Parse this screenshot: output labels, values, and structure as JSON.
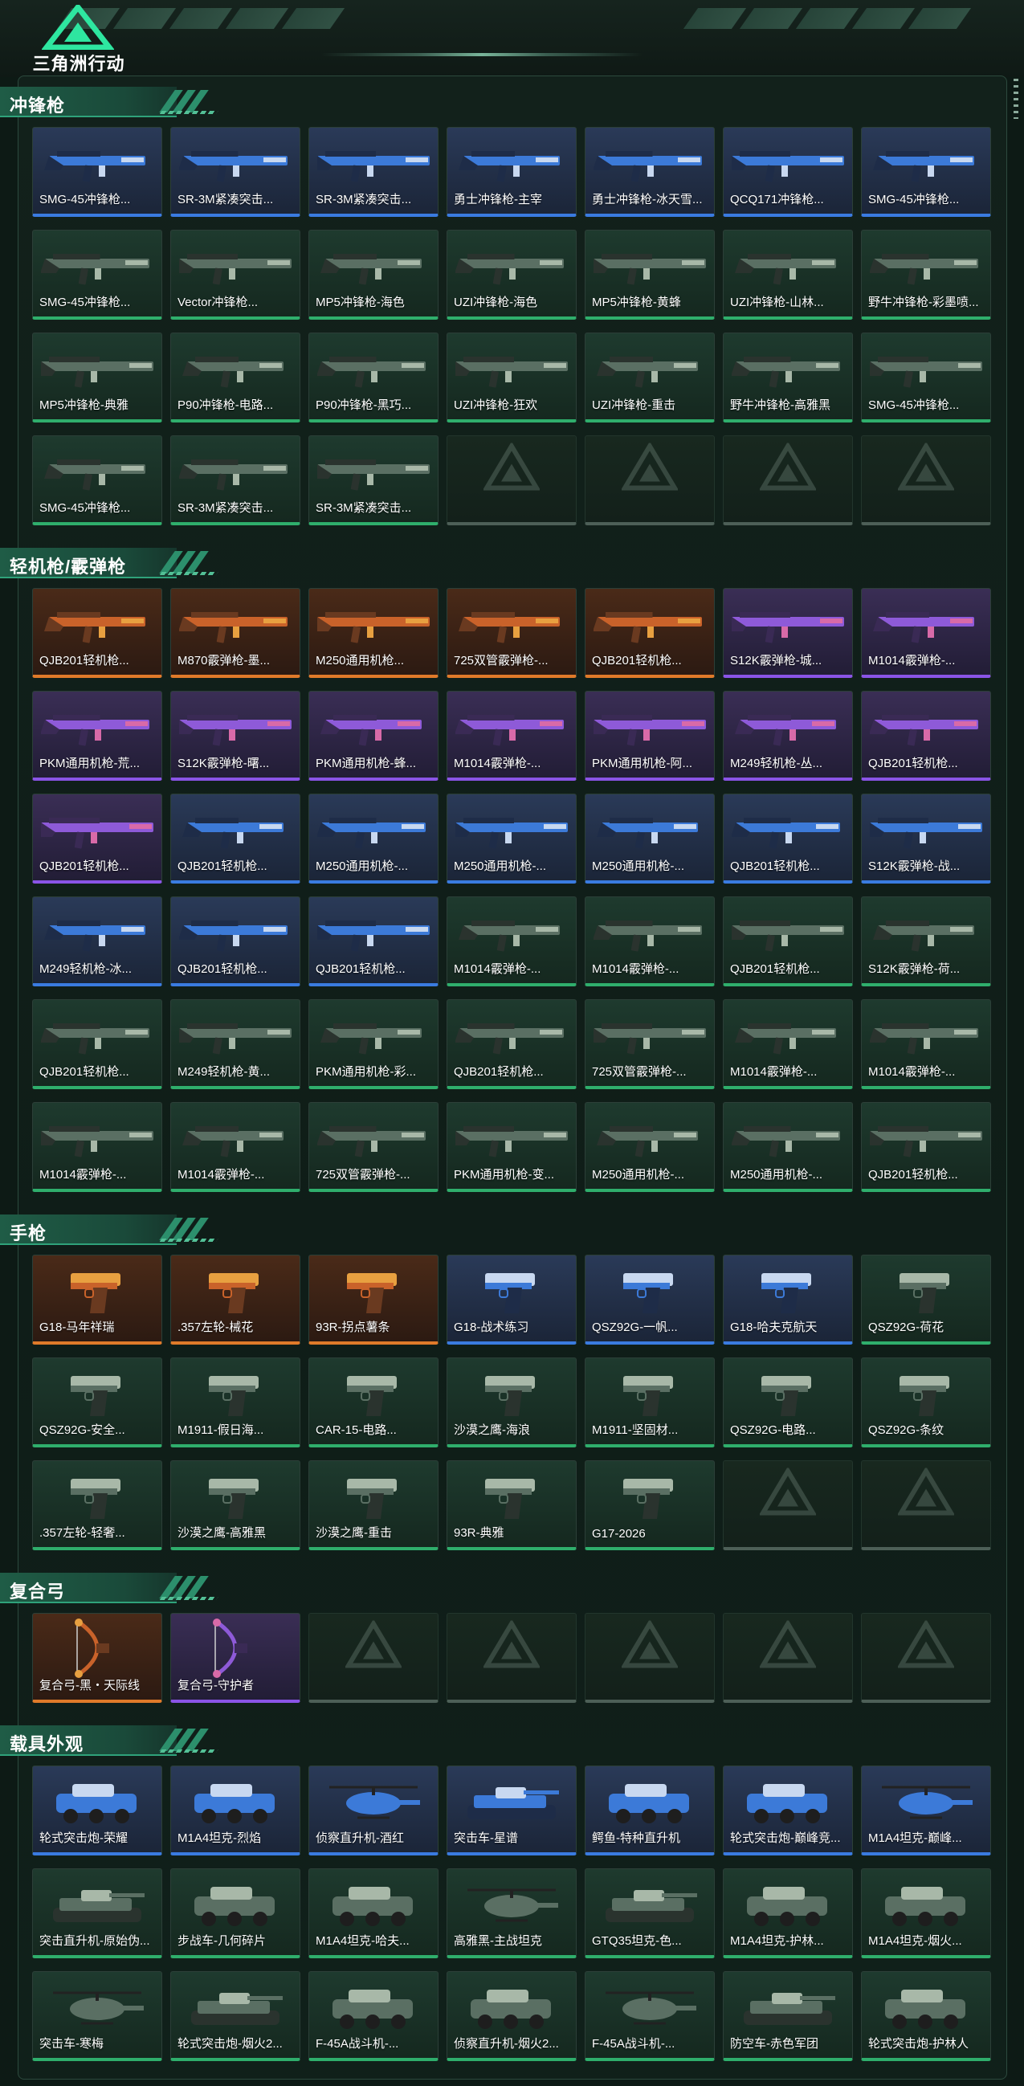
{
  "app": {
    "logo_text": "三角洲行动"
  },
  "colors": {
    "orange": "#e07a2a",
    "purple": "#8a54e6",
    "blue": "#3a7be0",
    "green": "#2fae6c",
    "accent": "#2fa27a"
  },
  "sections": [
    {
      "title": "冲锋枪",
      "kind": "gun",
      "items": [
        {
          "name": "SMG-45冲锋枪...",
          "rarity": "blue"
        },
        {
          "name": "SR-3M紧凑突击...",
          "rarity": "blue"
        },
        {
          "name": "SR-3M紧凑突击...",
          "rarity": "blue"
        },
        {
          "name": "勇士冲锋枪-主宰",
          "rarity": "blue"
        },
        {
          "name": "勇士冲锋枪-冰天雪...",
          "rarity": "blue"
        },
        {
          "name": "QCQ171冲锋枪...",
          "rarity": "blue"
        },
        {
          "name": "SMG-45冲锋枪...",
          "rarity": "blue"
        },
        {
          "name": "SMG-45冲锋枪...",
          "rarity": "green"
        },
        {
          "name": "Vector冲锋枪...",
          "rarity": "green"
        },
        {
          "name": "MP5冲锋枪-海色",
          "rarity": "green"
        },
        {
          "name": "UZI冲锋枪-海色",
          "rarity": "green"
        },
        {
          "name": "MP5冲锋枪-黄蜂",
          "rarity": "green"
        },
        {
          "name": "UZI冲锋枪-山林...",
          "rarity": "green"
        },
        {
          "name": "野牛冲锋枪-彩墨喷...",
          "rarity": "green"
        },
        {
          "name": "MP5冲锋枪-典雅",
          "rarity": "green"
        },
        {
          "name": "P90冲锋枪-电路...",
          "rarity": "green"
        },
        {
          "name": "P90冲锋枪-黑巧...",
          "rarity": "green"
        },
        {
          "name": "UZI冲锋枪-狂欢",
          "rarity": "green"
        },
        {
          "name": "UZI冲锋枪-重击",
          "rarity": "green"
        },
        {
          "name": "野牛冲锋枪-高雅黑",
          "rarity": "green"
        },
        {
          "name": "SMG-45冲锋枪...",
          "rarity": "green"
        },
        {
          "name": "SMG-45冲锋枪...",
          "rarity": "green"
        },
        {
          "name": "SR-3M紧凑突击...",
          "rarity": "green"
        },
        {
          "name": "SR-3M紧凑突击...",
          "rarity": "green"
        },
        {
          "name": "",
          "rarity": "empty"
        },
        {
          "name": "",
          "rarity": "empty"
        },
        {
          "name": "",
          "rarity": "empty"
        },
        {
          "name": "",
          "rarity": "empty"
        }
      ]
    },
    {
      "title": "轻机枪/霰弹枪",
      "kind": "gun",
      "items": [
        {
          "name": "QJB201轻机枪...",
          "rarity": "orange"
        },
        {
          "name": "M870霰弹枪-墨...",
          "rarity": "orange"
        },
        {
          "name": "M250通用机枪...",
          "rarity": "orange"
        },
        {
          "name": "725双管霰弹枪-...",
          "rarity": "orange"
        },
        {
          "name": "QJB201轻机枪...",
          "rarity": "orange"
        },
        {
          "name": "S12K霰弹枪-城...",
          "rarity": "purple"
        },
        {
          "name": "M1014霰弹枪-...",
          "rarity": "purple"
        },
        {
          "name": "PKM通用机枪-荒...",
          "rarity": "purple"
        },
        {
          "name": "S12K霰弹枪-曙...",
          "rarity": "purple"
        },
        {
          "name": "PKM通用机枪-蜂...",
          "rarity": "purple"
        },
        {
          "name": "M1014霰弹枪-...",
          "rarity": "purple"
        },
        {
          "name": "PKM通用机枪-阿...",
          "rarity": "purple"
        },
        {
          "name": "M249轻机枪-丛...",
          "rarity": "purple"
        },
        {
          "name": "QJB201轻机枪...",
          "rarity": "purple"
        },
        {
          "name": "QJB201轻机枪...",
          "rarity": "purple"
        },
        {
          "name": "QJB201轻机枪...",
          "rarity": "blue"
        },
        {
          "name": "M250通用机枪-...",
          "rarity": "blue"
        },
        {
          "name": "M250通用机枪-...",
          "rarity": "blue"
        },
        {
          "name": "M250通用机枪-...",
          "rarity": "blue"
        },
        {
          "name": "QJB201轻机枪...",
          "rarity": "blue"
        },
        {
          "name": "S12K霰弹枪-战...",
          "rarity": "blue"
        },
        {
          "name": "M249轻机枪-冰...",
          "rarity": "blue"
        },
        {
          "name": "QJB201轻机枪...",
          "rarity": "blue"
        },
        {
          "name": "QJB201轻机枪...",
          "rarity": "blue"
        },
        {
          "name": "M1014霰弹枪-...",
          "rarity": "green"
        },
        {
          "name": "M1014霰弹枪-...",
          "rarity": "green"
        },
        {
          "name": "QJB201轻机枪...",
          "rarity": "green"
        },
        {
          "name": "S12K霰弹枪-荷...",
          "rarity": "green"
        },
        {
          "name": "QJB201轻机枪...",
          "rarity": "green"
        },
        {
          "name": "M249轻机枪-黄...",
          "rarity": "green"
        },
        {
          "name": "PKM通用机枪-彩...",
          "rarity": "green"
        },
        {
          "name": "QJB201轻机枪...",
          "rarity": "green"
        },
        {
          "name": "725双管霰弹枪-...",
          "rarity": "green"
        },
        {
          "name": "M1014霰弹枪-...",
          "rarity": "green"
        },
        {
          "name": "M1014霰弹枪-...",
          "rarity": "green"
        },
        {
          "name": "M1014霰弹枪-...",
          "rarity": "green"
        },
        {
          "name": "M1014霰弹枪-...",
          "rarity": "green"
        },
        {
          "name": "725双管霰弹枪-...",
          "rarity": "green"
        },
        {
          "name": "PKM通用机枪-变...",
          "rarity": "green"
        },
        {
          "name": "M250通用机枪-...",
          "rarity": "green"
        },
        {
          "name": "M250通用机枪-...",
          "rarity": "green"
        },
        {
          "name": "QJB201轻机枪...",
          "rarity": "green"
        }
      ]
    },
    {
      "title": "手枪",
      "kind": "pistol",
      "items": [
        {
          "name": "G18-马年祥瑞",
          "rarity": "orange"
        },
        {
          "name": ".357左轮-械花",
          "rarity": "orange"
        },
        {
          "name": "93R-拐点薯条",
          "rarity": "orange"
        },
        {
          "name": "G18-战术练习",
          "rarity": "blue"
        },
        {
          "name": "QSZ92G-一帆...",
          "rarity": "blue"
        },
        {
          "name": "G18-哈夫克航天",
          "rarity": "blue"
        },
        {
          "name": "QSZ92G-荷花",
          "rarity": "green"
        },
        {
          "name": "QSZ92G-安全...",
          "rarity": "green"
        },
        {
          "name": "M1911-假日海...",
          "rarity": "green"
        },
        {
          "name": "CAR-15-电路...",
          "rarity": "green"
        },
        {
          "name": "沙漠之鹰-海浪",
          "rarity": "green"
        },
        {
          "name": "M1911-坚固材...",
          "rarity": "green"
        },
        {
          "name": "QSZ92G-电路...",
          "rarity": "green"
        },
        {
          "name": "QSZ92G-条纹",
          "rarity": "green"
        },
        {
          "name": ".357左轮-轻奢...",
          "rarity": "green"
        },
        {
          "name": "沙漠之鹰-高雅黑",
          "rarity": "green"
        },
        {
          "name": "沙漠之鹰-重击",
          "rarity": "green"
        },
        {
          "name": "93R-典雅",
          "rarity": "green"
        },
        {
          "name": "G17-2026",
          "rarity": "green"
        },
        {
          "name": "",
          "rarity": "empty"
        },
        {
          "name": "",
          "rarity": "empty"
        }
      ]
    },
    {
      "title": "复合弓",
      "kind": "bow",
      "items": [
        {
          "name": "复合弓-黑・天际线",
          "rarity": "orange"
        },
        {
          "name": "复合弓-守护者",
          "rarity": "purple"
        },
        {
          "name": "",
          "rarity": "empty"
        },
        {
          "name": "",
          "rarity": "empty"
        },
        {
          "name": "",
          "rarity": "empty"
        },
        {
          "name": "",
          "rarity": "empty"
        },
        {
          "name": "",
          "rarity": "empty"
        }
      ]
    },
    {
      "title": "载具外观",
      "kind": "vehicle",
      "items": [
        {
          "name": "轮式突击炮-荣耀",
          "rarity": "blue"
        },
        {
          "name": "M1A4坦克-烈焰",
          "rarity": "blue"
        },
        {
          "name": "侦察直升机-酒红",
          "rarity": "blue"
        },
        {
          "name": "突击车-星谱",
          "rarity": "blue"
        },
        {
          "name": "鳄鱼-特种直升机",
          "rarity": "blue"
        },
        {
          "name": "轮式突击炮-巅峰竞...",
          "rarity": "blue"
        },
        {
          "name": "M1A4坦克-巅峰...",
          "rarity": "blue"
        },
        {
          "name": "突击直升机-原始伪...",
          "rarity": "green"
        },
        {
          "name": "步战车-几何碎片",
          "rarity": "green"
        },
        {
          "name": "M1A4坦克-哈夫...",
          "rarity": "green"
        },
        {
          "name": "高雅黑-主战坦克",
          "rarity": "green"
        },
        {
          "name": "GTQ35坦克-色...",
          "rarity": "green"
        },
        {
          "name": "M1A4坦克-护林...",
          "rarity": "green"
        },
        {
          "name": "M1A4坦克-烟火...",
          "rarity": "green"
        },
        {
          "name": "突击车-寒梅",
          "rarity": "green"
        },
        {
          "name": "轮式突击炮-烟火2...",
          "rarity": "green"
        },
        {
          "name": "F-45A战斗机-...",
          "rarity": "green"
        },
        {
          "name": "侦察直升机-烟火2...",
          "rarity": "green"
        },
        {
          "name": "F-45A战斗机-...",
          "rarity": "green"
        },
        {
          "name": "防空车-赤色军团",
          "rarity": "green"
        },
        {
          "name": "轮式突击炮-护林人",
          "rarity": "green"
        }
      ]
    }
  ]
}
